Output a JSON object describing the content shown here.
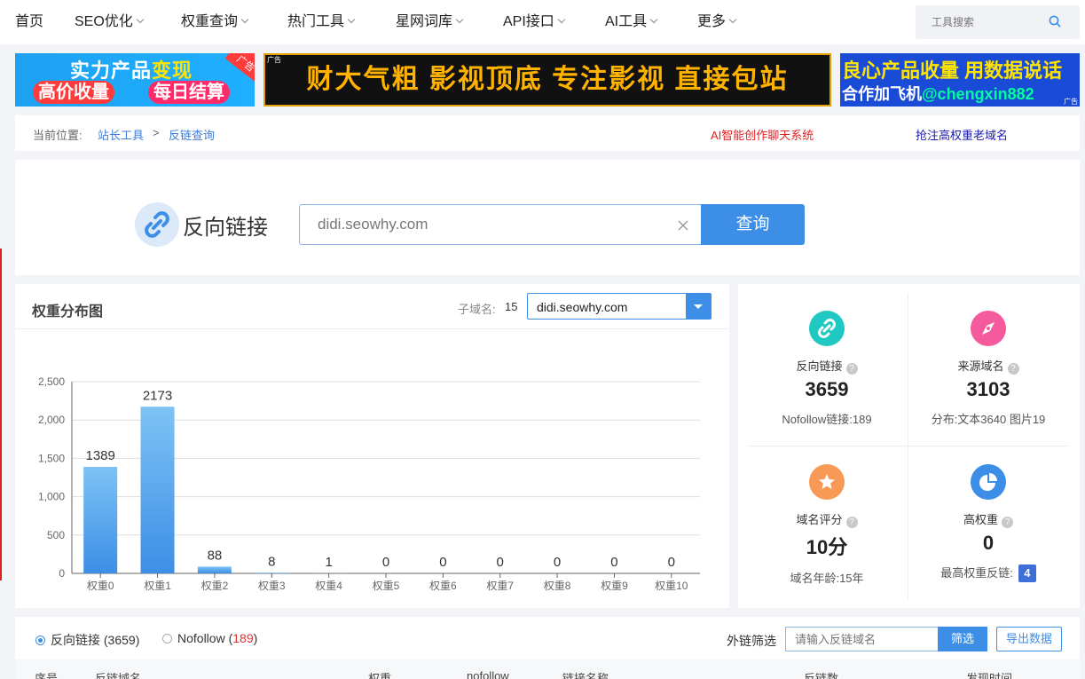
{
  "nav": {
    "items": [
      {
        "label": "首页",
        "has_menu": false
      },
      {
        "label": "SEO优化",
        "has_menu": true
      },
      {
        "label": "权重查询",
        "has_menu": true
      },
      {
        "label": "热门工具",
        "has_menu": true
      },
      {
        "label": "星网词库",
        "has_menu": true
      },
      {
        "label": "API接口",
        "has_menu": true
      },
      {
        "label": "AI工具",
        "has_menu": true
      },
      {
        "label": "更多",
        "has_menu": true
      }
    ],
    "search_placeholder": "工具搜索"
  },
  "ads": {
    "b1_line1_a": "实力产品",
    "b1_line1_b": "变现",
    "b1_pill1": "高价收量",
    "b1_pill2": "每日结算",
    "b1_corner": "广告",
    "b2_text": "财大气粗 影视顶底 专注影视 直接包站",
    "b2_ad": "广告",
    "b3_line1": "良心产品收量 用数据说话",
    "b3_line2_a": "合作加飞机",
    "b3_line2_b": "@chengxin882",
    "b3_ad": "广告"
  },
  "breadcrumb": {
    "label": "当前位置:",
    "items": [
      "站长工具",
      "反链查询"
    ],
    "separator": ">",
    "link_ai": "AI智能创作聊天系统",
    "link_domain": "抢注高权重老域名"
  },
  "query": {
    "title": "反向链接",
    "input_value": "didi.seowhy.com",
    "button": "查询"
  },
  "chart_panel": {
    "title": "权重分布图",
    "subdomain_label": "子域名:",
    "subdomain_count": "15",
    "select_value": "didi.seowhy.com"
  },
  "chart_data": {
    "type": "bar",
    "categories": [
      "权重0",
      "权重1",
      "权重2",
      "权重3",
      "权重4",
      "权重5",
      "权重6",
      "权重7",
      "权重8",
      "权重9",
      "权重10"
    ],
    "values": [
      1389,
      2173,
      88,
      8,
      1,
      0,
      0,
      0,
      0,
      0,
      0
    ],
    "yticks": [
      "0",
      "500",
      "1,000",
      "1,500",
      "2,000",
      "2,500"
    ],
    "ylim": [
      0,
      2500
    ],
    "grid": true,
    "bar_color_top": "#7cc3f5",
    "bar_color_bottom": "#3d8ee6"
  },
  "stats": [
    {
      "label": "反向链接",
      "value": "3659",
      "sub": "Nofollow链接:189",
      "icon": "link-icon",
      "color": "#1fc8c0"
    },
    {
      "label": "来源域名",
      "value": "3103",
      "sub": "分布:文本3640 图片19",
      "icon": "compass-icon",
      "color": "#f55b9c"
    },
    {
      "label": "域名评分",
      "value": "10分",
      "sub": "域名年龄:15年",
      "icon": "star-icon",
      "color": "#f89a56"
    },
    {
      "label": "高权重",
      "value": "0",
      "sub": "最高权重反链:",
      "badge": "4",
      "icon": "pie-chart-icon",
      "color": "#3d8ee6"
    }
  ],
  "list": {
    "radio_backlinks_label": "反向链接",
    "radio_backlinks_count": "(3659)",
    "radio_nofollow_label": "Nofollow",
    "radio_nofollow_count": "189",
    "filter_label": "外链筛选",
    "filter_placeholder": "请输入反链域名",
    "filter_button": "筛选",
    "export_button": "导出数据",
    "columns": [
      "序号",
      "反链域名",
      "权重",
      "nofollow",
      "链接名称",
      "反链数",
      "发现时间"
    ]
  }
}
